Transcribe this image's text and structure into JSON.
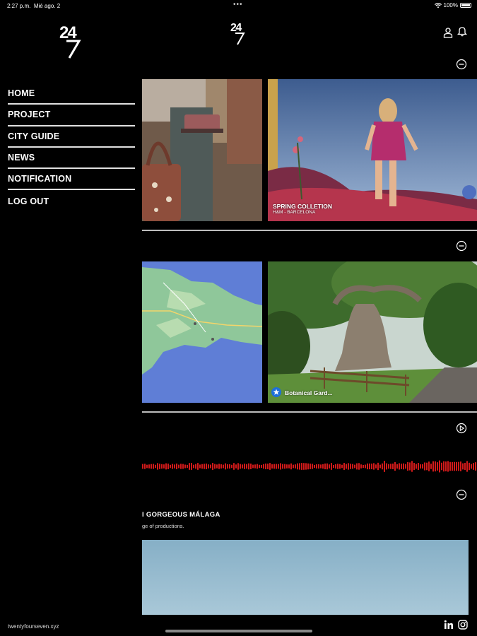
{
  "status_bar": {
    "time": "2:27 p.m.",
    "date": "Mié ago. 2",
    "battery": "100%"
  },
  "brand": {
    "logo_text": "24/7",
    "footer_site": "twentyfourseven.xyz"
  },
  "sidebar": {
    "items": [
      {
        "label": "HOME"
      },
      {
        "label": "PROJECT"
      },
      {
        "label": "CITY GUIDE"
      },
      {
        "label": "NEWS"
      },
      {
        "label": "NOTIFICATION"
      },
      {
        "label": "LOG OUT"
      }
    ]
  },
  "header_icons": [
    "user-icon",
    "bell-icon"
  ],
  "feed": {
    "cards": [
      {
        "title": "SPRING COLLETION",
        "subtitle": "H&M - BARCELONA"
      },
      {
        "title": "Botanical Gard..."
      }
    ],
    "section": {
      "heading": "I GORGEOUS MÁLAGA",
      "subheading": "ge of productions."
    }
  },
  "social_icons": [
    "linkedin-icon",
    "instagram-icon"
  ],
  "colors": {
    "background": "#000000",
    "separator": "#bdbdbd",
    "wave": "#d11a1a",
    "badge": "#1e6fd9"
  }
}
